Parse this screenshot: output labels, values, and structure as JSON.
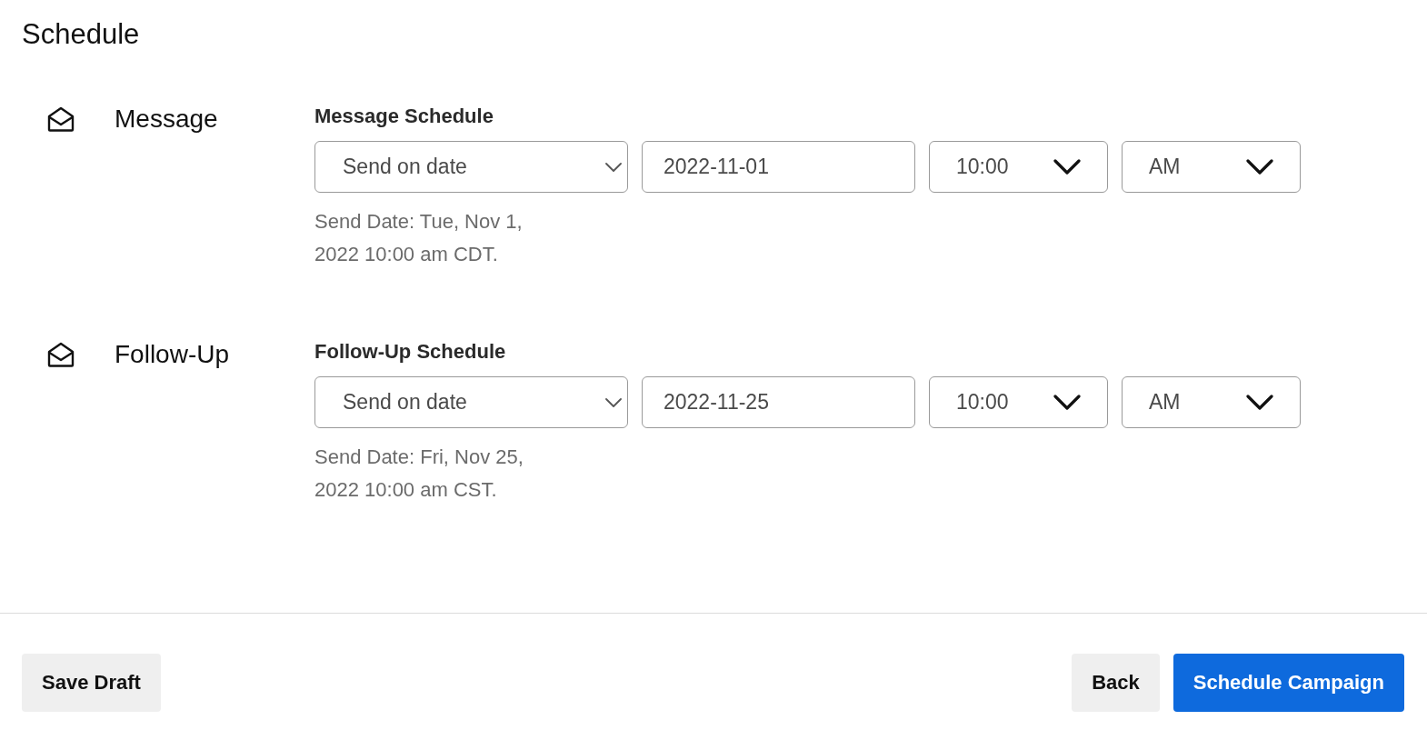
{
  "title": "Schedule",
  "sections": [
    {
      "name": "Message",
      "schedule_label": "Message Schedule",
      "send_mode": "Send on date",
      "date": "2022-11-01",
      "time": "10:00",
      "period": "AM",
      "summary": "Send Date: Tue, Nov 1, 2022 10:00 am CDT."
    },
    {
      "name": "Follow-Up",
      "schedule_label": "Follow-Up Schedule",
      "send_mode": "Send on date",
      "date": "2022-11-25",
      "time": "10:00",
      "period": "AM",
      "summary": "Send Date: Fri, Nov 25, 2022 10:00 am CST."
    }
  ],
  "footer": {
    "left_buttons": [
      {
        "label": "Save Draft",
        "kind": "secondary"
      }
    ],
    "right_buttons": [
      {
        "label": "Back",
        "kind": "secondary"
      },
      {
        "label": "Schedule Campaign",
        "kind": "primary"
      }
    ]
  }
}
